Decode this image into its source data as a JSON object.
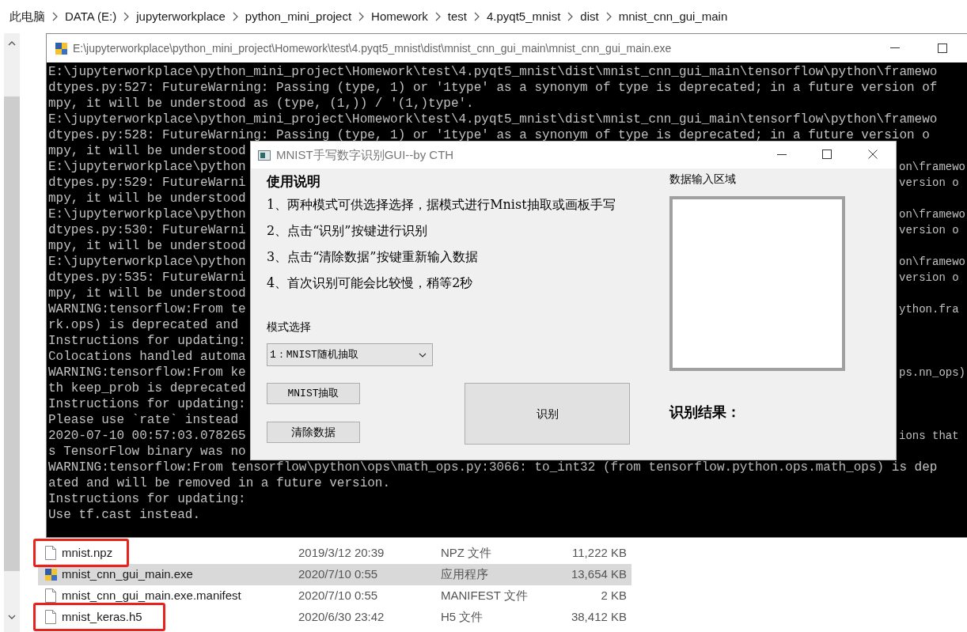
{
  "explorer": {
    "breadcrumb": [
      "此电脑",
      "DATA (E:)",
      "jupyterworkplace",
      "python_mini_project",
      "Homework",
      "test",
      "4.pyqt5_mnist",
      "dist",
      "mnist_cnn_gui_main"
    ],
    "files": [
      {
        "name": "mnist.npz",
        "date": "2019/3/12 20:39",
        "type": "NPZ 文件",
        "size": "11,222 KB",
        "kind": "file",
        "selected": false,
        "marked": true
      },
      {
        "name": "mnist_cnn_gui_main.exe",
        "date": "2020/7/10 0:55",
        "type": "应用程序",
        "size": "13,654 KB",
        "kind": "exe",
        "selected": true,
        "marked": false
      },
      {
        "name": "mnist_cnn_gui_main.exe.manifest",
        "date": "2020/7/10 0:55",
        "type": "MANIFEST 文件",
        "size": "2 KB",
        "kind": "file",
        "selected": false,
        "marked": false
      },
      {
        "name": "mnist_keras.h5",
        "date": "2020/6/30 23:42",
        "type": "H5 文件",
        "size": "38,412 KB",
        "kind": "file",
        "selected": false,
        "marked": true
      }
    ]
  },
  "console": {
    "title": "E:\\jupyterworkplace\\python_mini_project\\Homework\\test\\4.pyqt5_mnist\\dist\\mnist_cnn_gui_main\\mnist_cnn_gui_main.exe",
    "lines": [
      {
        "kind": "full",
        "text": "E:\\jupyterworkplace\\python_mini_project\\Homework\\test\\4.pyqt5_mnist\\dist\\mnist_cnn_gui_main\\tensorflow\\python\\framewo"
      },
      {
        "kind": "full",
        "text": "dtypes.py:527: FutureWarning: Passing (type, 1) or '1type' as a synonym of type is deprecated; in a future version of"
      },
      {
        "kind": "full",
        "text": "mpy, it will be understood as (type, (1,)) / '(1,)type'."
      },
      {
        "kind": "full",
        "text": "E:\\jupyterworkplace\\python_mini_project\\Homework\\test\\4.pyqt5_mnist\\dist\\mnist_cnn_gui_main\\tensorflow\\python\\framewo"
      },
      {
        "kind": "full",
        "text": "dtypes.py:528: FutureWarning: Passing (type, 1) or '1type' as a synonym of type is deprecated; in a future version o"
      },
      {
        "kind": "split",
        "left": "mpy, it will be understood"
      },
      {
        "kind": "split",
        "left": "E:\\jupyterworkplace\\python",
        "right": "on\\framewo"
      },
      {
        "kind": "split",
        "left": "dtypes.py:529: FutureWarni",
        "right": "version o"
      },
      {
        "kind": "split",
        "left": "mpy, it will be understood"
      },
      {
        "kind": "split",
        "left": "E:\\jupyterworkplace\\python",
        "right": "on\\framewo"
      },
      {
        "kind": "split",
        "left": "dtypes.py:530: FutureWarni",
        "right": "version o"
      },
      {
        "kind": "split",
        "left": "mpy, it will be understood"
      },
      {
        "kind": "split",
        "left": "E:\\jupyterworkplace\\python",
        "right": "on\\framewo"
      },
      {
        "kind": "split",
        "left": "dtypes.py:535: FutureWarni",
        "right": "version o"
      },
      {
        "kind": "split",
        "left": "mpy, it will be understood"
      },
      {
        "kind": "split",
        "left": "WARNING:tensorflow:From te",
        "right": "ython.fra"
      },
      {
        "kind": "split",
        "left": "rk.ops) is deprecated and"
      },
      {
        "kind": "split",
        "left": "Instructions for updating:"
      },
      {
        "kind": "split",
        "left": "Colocations handled automa"
      },
      {
        "kind": "split",
        "left": "WARNING:tensorflow:From ke",
        "right": "ps.nn_ops)"
      },
      {
        "kind": "split",
        "left": "th keep_prob is deprecated"
      },
      {
        "kind": "split",
        "left": "Instructions for updating:"
      },
      {
        "kind": "split",
        "left": "Please use `rate` instead"
      },
      {
        "kind": "split",
        "left": "2020-07-10 00:57:03.078265",
        "right": "ions that"
      },
      {
        "kind": "split",
        "left": "s TensorFlow binary was no"
      },
      {
        "kind": "full",
        "text": "WARNING:tensorflow:From tensorflow\\python\\ops\\math_ops.py:3066: to_int32 (from tensorflow.python.ops.math_ops) is dep"
      },
      {
        "kind": "full",
        "text": "ated and will be removed in a future version."
      },
      {
        "kind": "full",
        "text": "Instructions for updating:"
      },
      {
        "kind": "full",
        "text": "Use tf.cast instead."
      }
    ]
  },
  "gui": {
    "title": "MNIST手写数字识别GUI--by CTH",
    "heading": "使用说明",
    "instructions": [
      "1、两种模式可供选择选择，据模式进行Mnist抽取或画板手写",
      "2、点击“识别”按键进行识别",
      "3、点击“清除数据”按键重新输入数据",
      "4、首次识别可能会比较慢，稍等2秒"
    ],
    "mode_label": "模式选择",
    "mode_value": "1：MNIST随机抽取",
    "extract_button": "MNIST抽取",
    "clear_button": "清除数据",
    "recognize_button": "识别",
    "input_label": "数据输入区域",
    "result_label": "识别结果："
  }
}
